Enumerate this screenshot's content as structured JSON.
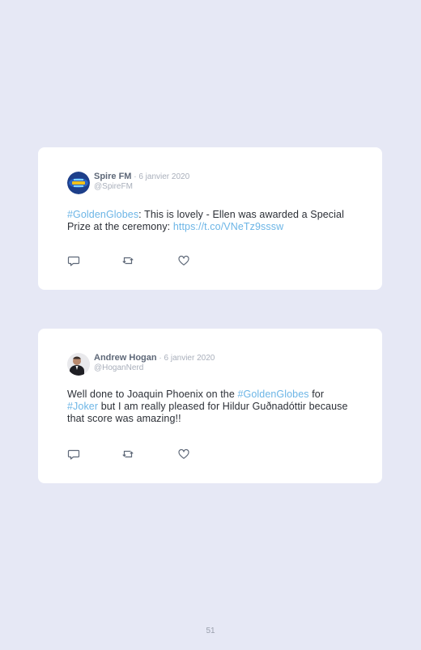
{
  "tweets": [
    {
      "name": "Spire FM",
      "separator": " · ",
      "date": "6 janvier 2020",
      "handle": "@SpireFM",
      "avatar_icon": "spire-fm-logo",
      "body": {
        "hashtag": "#GoldenGlobes",
        "text1": ": This is lovely - Ellen was awarded a Special Prize at the ceremony: ",
        "link": "https://t.co/VNeTz9sssw"
      }
    },
    {
      "name": "Andrew Hogan",
      "separator": " · ",
      "date": "6 janvier 2020",
      "handle": "@HoganNerd",
      "avatar_icon": "user-photo",
      "body": {
        "text1": "Well done to Joaquin Phoenix on the ",
        "hashtag1": "#GoldenGlobes",
        "text2": " for ",
        "hashtag2": "#Joker",
        "text3": " but I am really pleased for Hildur Guðnadóttir because that score was amazing!!"
      }
    }
  ],
  "actions": {
    "reply_icon": "reply-icon",
    "retweet_icon": "retweet-icon",
    "like_icon": "heart-icon"
  },
  "colors": {
    "background": "#e6e8f5",
    "card": "#ffffff",
    "link": "#6cb5e6",
    "name": "#5e6878",
    "muted": "#a9afbb"
  },
  "page_number": "51"
}
